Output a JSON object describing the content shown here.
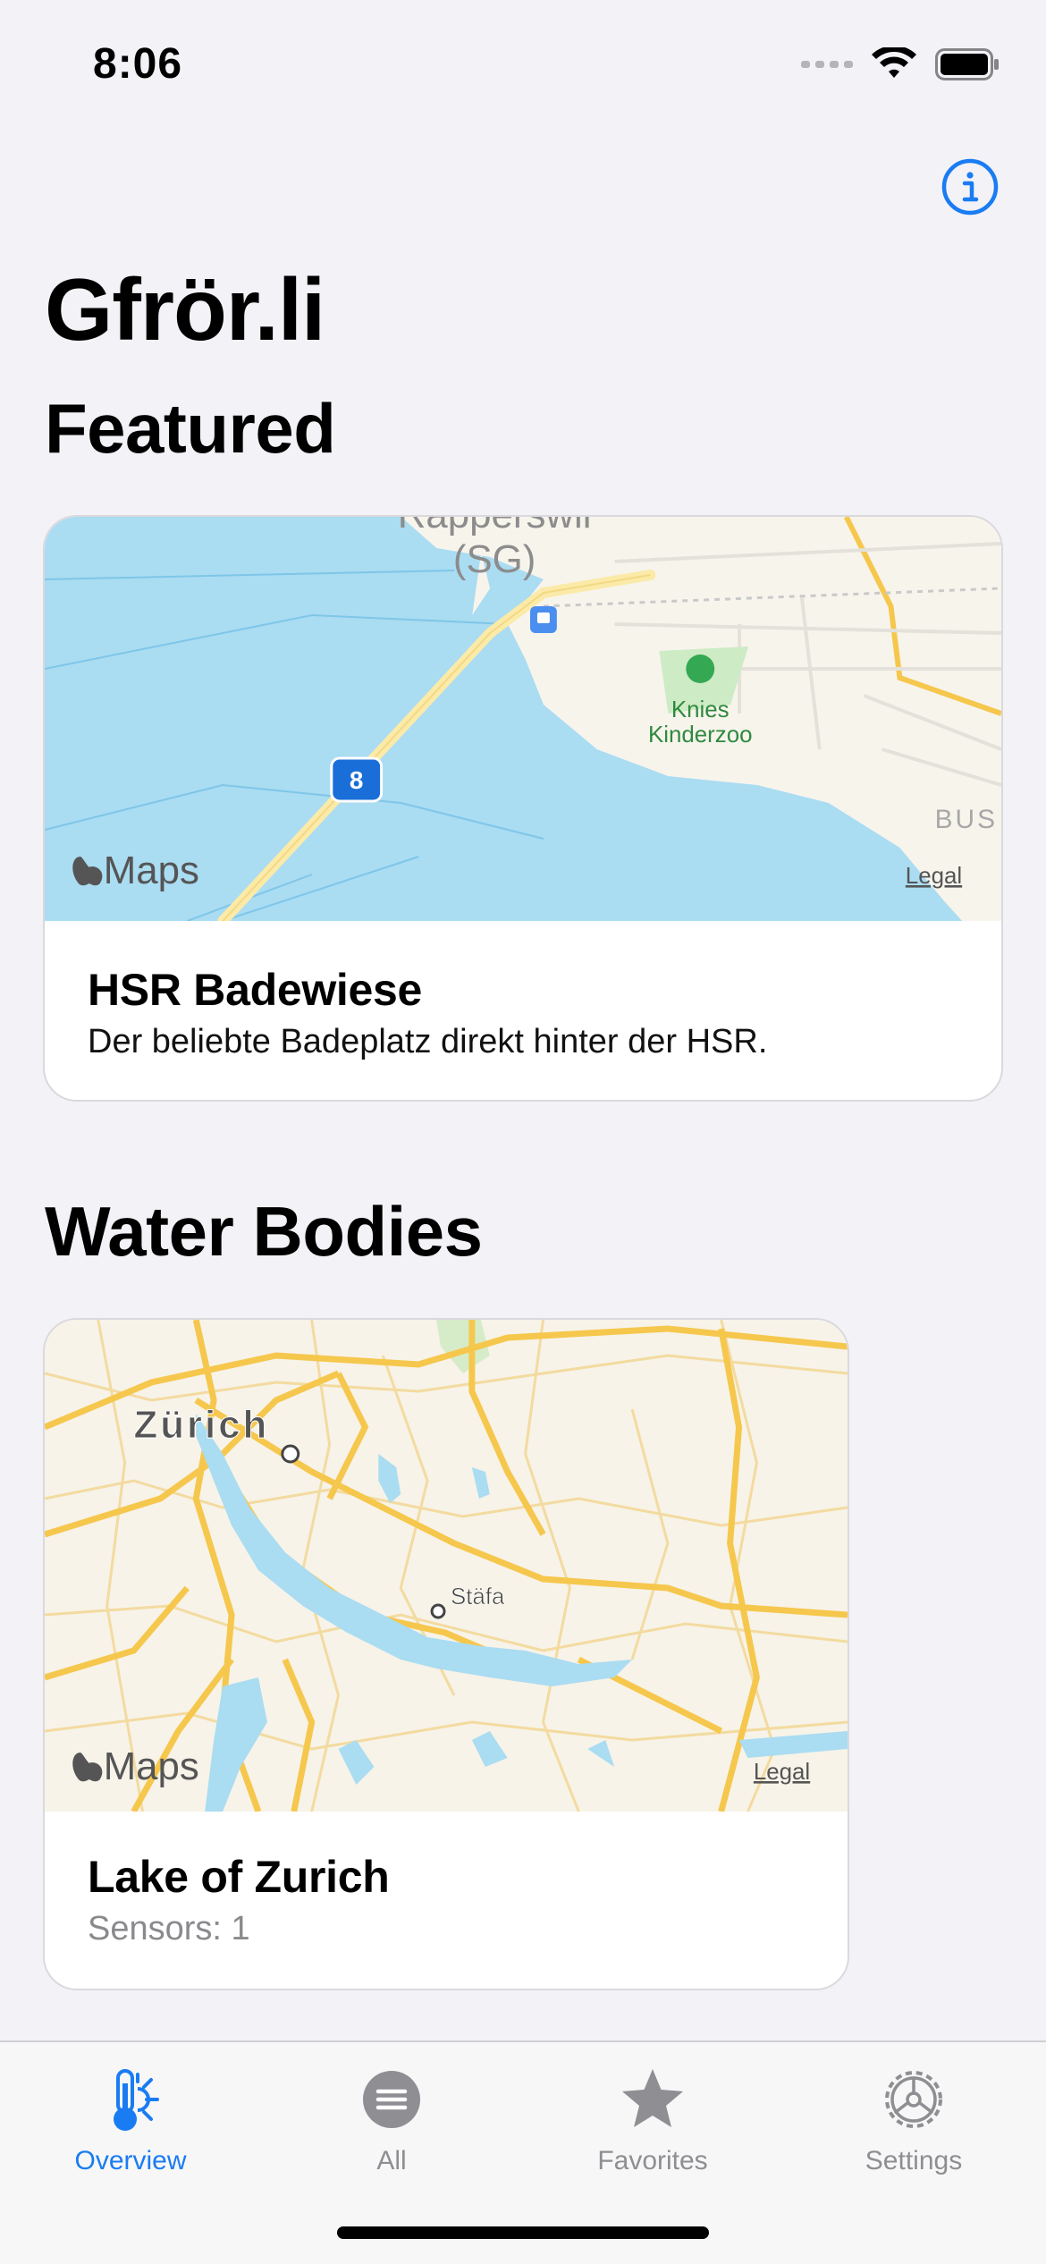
{
  "status_bar": {
    "time": "8:06",
    "icons": [
      "cellular-signal-icon",
      "wifi-icon",
      "battery-icon"
    ]
  },
  "header": {
    "info_icon": "info-circle-icon",
    "title": "Gfrör.li"
  },
  "featured": {
    "section_title": "Featured",
    "card": {
      "title": "HSR Badewiese",
      "description": "Der beliebte Badeplatz direkt hinter der HSR.",
      "map": {
        "attribution": "Maps",
        "legal": "Legal",
        "labels": {
          "town": "Rapperswil",
          "town_suffix": "(SG)",
          "zoo_line1": "Knies",
          "zoo_line2": "Kinderzoo",
          "road_shield": "8",
          "bus": "BUS"
        }
      }
    }
  },
  "water_bodies": {
    "section_title": "Water Bodies",
    "items": [
      {
        "title": "Lake of Zurich",
        "subtitle": "Sensors: 1",
        "map": {
          "attribution": "Maps",
          "legal": "Legal",
          "labels": {
            "city": "Zürich",
            "town": "Stäfa"
          }
        }
      }
    ]
  },
  "tab_bar": {
    "tabs": [
      {
        "label": "Overview",
        "icon": "thermometer-sun-icon",
        "active": true
      },
      {
        "label": "All",
        "icon": "list-circle-icon",
        "active": false
      },
      {
        "label": "Favorites",
        "icon": "star-icon",
        "active": false
      },
      {
        "label": "Settings",
        "icon": "gear-icon",
        "active": false
      }
    ]
  },
  "colors": {
    "accent": "#1a7cf2",
    "background": "#f2f2f7",
    "water": "#aadcf2",
    "land": "#f7f4ec",
    "road_major": "#f6c74d",
    "inactive": "#8e8e93"
  }
}
